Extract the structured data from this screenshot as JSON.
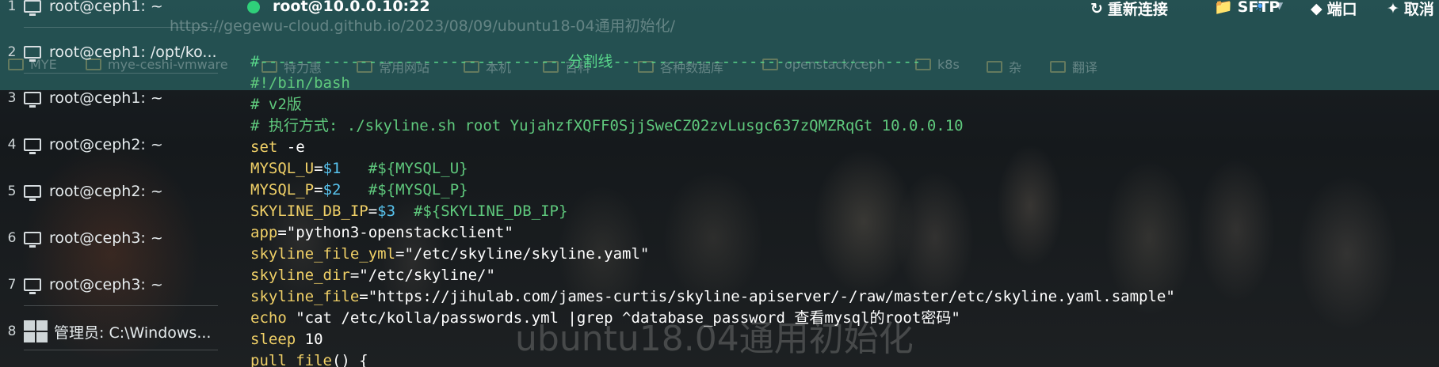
{
  "browser_overlay": {
    "url": "https://gegewu-cloud.github.io/2023/08/09/ubuntu18-04通用初始化/",
    "bookmarks": [
      "MYE",
      "mye-ceshi-vmware",
      "特力惠",
      "常用网站",
      "本机",
      "百科",
      "各种数据库",
      "openstack/ceph",
      "k8s",
      "杂",
      "翻译"
    ]
  },
  "sidebar": {
    "tabs": [
      {
        "num": "1",
        "label": "root@ceph1: ~",
        "icon": "monitor-icon"
      },
      {
        "num": "2",
        "label": "root@ceph1: /opt/ko...",
        "icon": "monitor-icon"
      },
      {
        "num": "3",
        "label": "root@ceph1: ~",
        "icon": "monitor-icon"
      },
      {
        "num": "4",
        "label": "root@ceph2: ~",
        "icon": "monitor-icon"
      },
      {
        "num": "5",
        "label": "root@ceph2: ~",
        "icon": "monitor-icon"
      },
      {
        "num": "6",
        "label": "root@ceph3: ~",
        "icon": "monitor-icon"
      },
      {
        "num": "7",
        "label": "root@ceph3: ~",
        "icon": "monitor-icon"
      },
      {
        "num": "8",
        "label": "管理员: C:\\Windows...",
        "icon": "windows-icon"
      }
    ]
  },
  "header": {
    "title": "root@10.0.0.10:22",
    "status_color": "#2fd07a",
    "buttons": {
      "reconnect": "重新连接",
      "sftp": "SFTP",
      "port": "端口",
      "cancel": "取消"
    }
  },
  "terminal": {
    "lines": [
      {
        "parts": [
          [
            "div",
            "#----------------------------------分割线----------------------------------"
          ]
        ]
      },
      {
        "parts": [
          [
            "comment",
            "#!/bin/bash"
          ]
        ]
      },
      {
        "parts": [
          [
            "comment",
            "# v2版"
          ]
        ]
      },
      {
        "parts": [
          [
            "comment",
            "# 执行方式: ./skyline.sh root YujahzfXQFF0SjjSweCZ02zvLusgc637zQMZRqGt 10.0.0.10"
          ]
        ]
      },
      {
        "parts": [
          [
            "kw",
            "set"
          ],
          [
            "op",
            " -e"
          ]
        ]
      },
      {
        "parts": [
          [
            "var",
            "MYSQL_U"
          ],
          [
            "op",
            "="
          ],
          [
            "num",
            "$1"
          ],
          [
            "op",
            "   "
          ],
          [
            "comment",
            "#${MYSQL_U}"
          ]
        ]
      },
      {
        "parts": [
          [
            "var",
            "MYSQL_P"
          ],
          [
            "op",
            "="
          ],
          [
            "num",
            "$2"
          ],
          [
            "op",
            "   "
          ],
          [
            "comment",
            "#${MYSQL_P}"
          ]
        ]
      },
      {
        "parts": [
          [
            "var",
            "SKYLINE_DB_IP"
          ],
          [
            "op",
            "="
          ],
          [
            "num",
            "$3"
          ],
          [
            "op",
            "  "
          ],
          [
            "comment",
            "#${SKYLINE_DB_IP}"
          ]
        ]
      },
      {
        "parts": [
          [
            "var",
            "app"
          ],
          [
            "op",
            "="
          ],
          [
            "str",
            "\"python3-openstackclient\""
          ]
        ]
      },
      {
        "parts": [
          [
            "var",
            "skyline_file_yml"
          ],
          [
            "op",
            "="
          ],
          [
            "str",
            "\"/etc/skyline/skyline.yaml\""
          ]
        ]
      },
      {
        "parts": [
          [
            "var",
            "skyline_dir"
          ],
          [
            "op",
            "="
          ],
          [
            "str",
            "\"/etc/skyline/\""
          ]
        ]
      },
      {
        "parts": [
          [
            "var",
            "skyline_file"
          ],
          [
            "op",
            "="
          ],
          [
            "str",
            "\"https://jihulab.com/james-curtis/skyline-apiserver/-/raw/master/etc/skyline.yaml.sample\""
          ]
        ]
      },
      {
        "parts": [
          [
            "kw",
            "echo"
          ],
          [
            "op",
            " "
          ],
          [
            "str",
            "\"cat /etc/kolla/passwords.yml |grep ^database_password 查看mysql的root密码\""
          ]
        ]
      },
      {
        "parts": [
          [
            "kw",
            "sleep"
          ],
          [
            "op",
            " 10"
          ]
        ]
      },
      {
        "parts": [
          [
            "var",
            "pull_file"
          ],
          [
            "op",
            "() {"
          ]
        ]
      }
    ]
  },
  "watermark": "ubuntu18.04通用初始化"
}
